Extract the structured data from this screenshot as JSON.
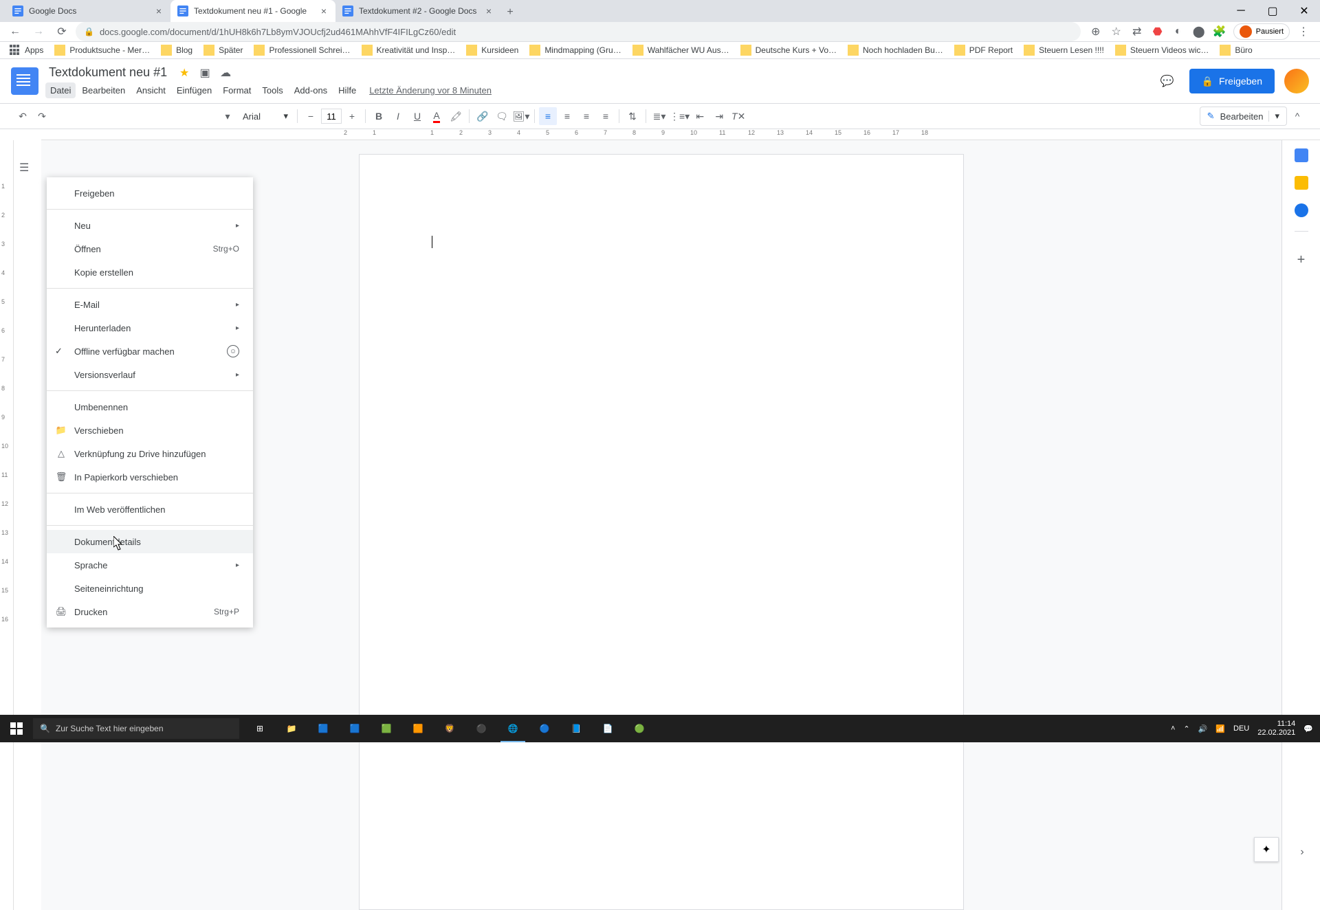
{
  "browser": {
    "tabs": [
      {
        "title": "Google Docs",
        "active": false
      },
      {
        "title": "Textdokument neu #1 - Google",
        "active": true
      },
      {
        "title": "Textdokument #2 - Google Docs",
        "active": false
      }
    ],
    "url": "docs.google.com/document/d/1hUH8k6h7Lb8ymVJOUcfj2ud461MAhhVfF4IFILgCz60/edit",
    "pause_label": "Pausiert",
    "bookmarks": [
      "Apps",
      "Produktsuche - Mer…",
      "Blog",
      "Später",
      "Professionell Schrei…",
      "Kreativität und Insp…",
      "Kursideen",
      "Mindmapping (Gru…",
      "Wahlfächer WU Aus…",
      "Deutsche Kurs + Vo…",
      "Noch hochladen Bu…",
      "PDF Report",
      "Steuern Lesen !!!!",
      "Steuern Videos wic…",
      "Büro"
    ]
  },
  "docs": {
    "title": "Textdokument neu #1",
    "menus": [
      "Datei",
      "Bearbeiten",
      "Ansicht",
      "Einfügen",
      "Format",
      "Tools",
      "Add-ons",
      "Hilfe"
    ],
    "last_edit": "Letzte Änderung vor 8 Minuten",
    "share_label": "Freigeben",
    "font": "Arial",
    "font_size": "11",
    "edit_mode": "Bearbeiten",
    "ruler_h": [
      "2",
      "1",
      "",
      "1",
      "2",
      "3",
      "4",
      "5",
      "6",
      "7",
      "8",
      "9",
      "10",
      "11",
      "12",
      "13",
      "14",
      "15",
      "16",
      "17",
      "18"
    ],
    "ruler_v": [
      "",
      "1",
      "2",
      "3",
      "4",
      "5",
      "6",
      "7",
      "8",
      "9",
      "10",
      "11",
      "12",
      "13",
      "14",
      "15",
      "16"
    ]
  },
  "file_menu": {
    "items": [
      {
        "label": "Freigeben"
      },
      {
        "sep": true
      },
      {
        "label": "Neu",
        "arrow": true
      },
      {
        "label": "Öffnen",
        "shortcut": "Strg+O"
      },
      {
        "label": "Kopie erstellen"
      },
      {
        "sep": true
      },
      {
        "label": "E-Mail",
        "arrow": true
      },
      {
        "label": "Herunterladen",
        "arrow": true
      },
      {
        "label": "Offline verfügbar machen",
        "check": true,
        "extra": true
      },
      {
        "label": "Versionsverlauf",
        "arrow": true
      },
      {
        "sep": true
      },
      {
        "label": "Umbenennen"
      },
      {
        "label": "Verschieben",
        "icon": "folder"
      },
      {
        "label": "Verknüpfung zu Drive hinzufügen",
        "icon": "drive"
      },
      {
        "label": "In Papierkorb verschieben",
        "icon": "trash"
      },
      {
        "sep": true
      },
      {
        "label": "Im Web veröffentlichen"
      },
      {
        "sep": true
      },
      {
        "label": "Dokumentdetails",
        "hover": true
      },
      {
        "label": "Sprache",
        "arrow": true
      },
      {
        "label": "Seiteneinrichtung"
      },
      {
        "label": "Drucken",
        "shortcut": "Strg+P",
        "icon": "print"
      }
    ]
  },
  "taskbar": {
    "search_placeholder": "Zur Suche Text hier eingeben",
    "lang": "DEU",
    "time": "11:14",
    "date": "22.02.2021"
  }
}
